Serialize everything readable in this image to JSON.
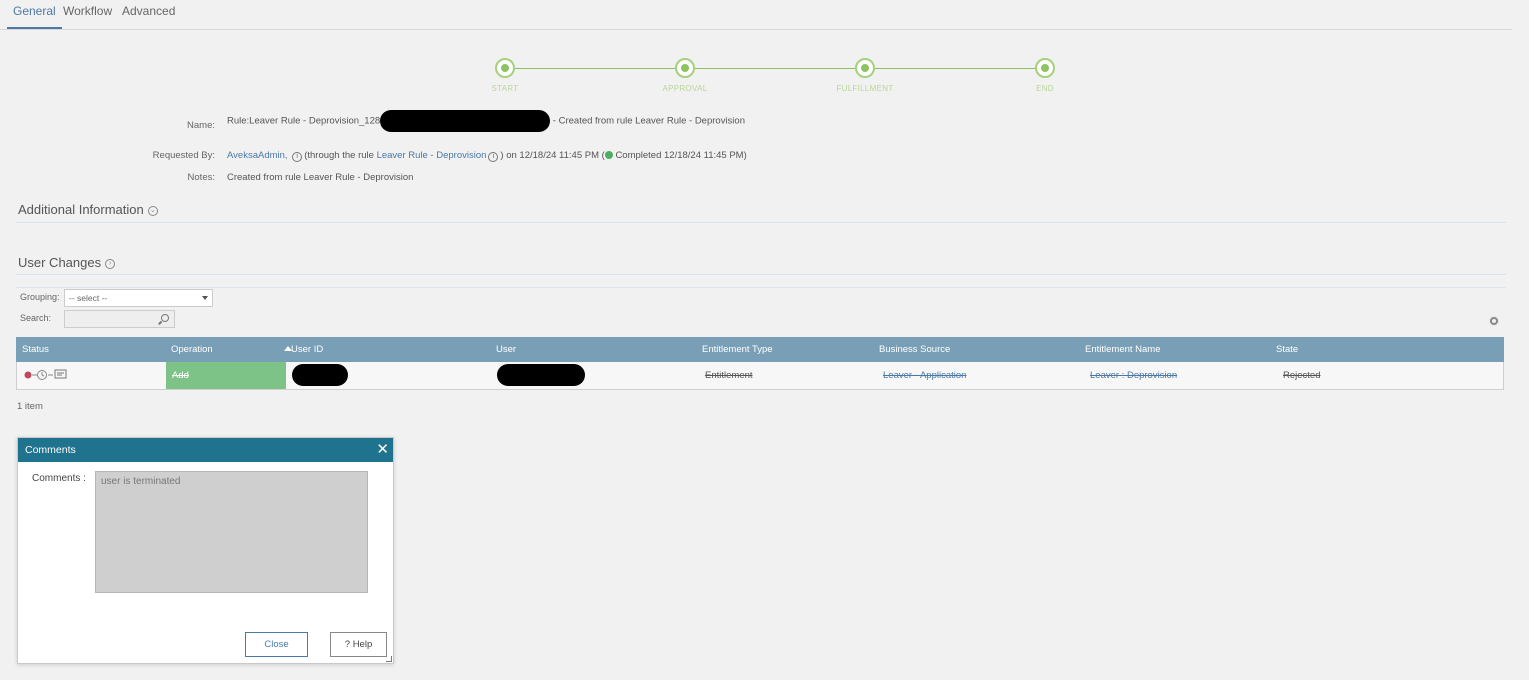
{
  "tabs": [
    {
      "label": "General",
      "active": true
    },
    {
      "label": "Workflow",
      "active": false
    },
    {
      "label": "Advanced",
      "active": false
    }
  ],
  "progress": {
    "steps": [
      "START",
      "APPROVAL",
      "FULFILLMENT",
      "END"
    ]
  },
  "details": {
    "name_label": "Name:",
    "name_prefix": "Rule:Leaver Rule - Deprovision_128",
    "name_suffix": "- Created from rule Leaver Rule - Deprovision",
    "requested_label": "Requested By:",
    "requester": "AveksaAdmin,",
    "through_text": "(through the rule",
    "rule_link": "Leaver Rule - Deprovision",
    "on_text": ") on 12/18/24 11:45 PM (",
    "completed_text": "Completed 12/18/24 11:45 PM)",
    "notes_label": "Notes:",
    "notes": "Created from rule Leaver Rule - Deprovision"
  },
  "sections": {
    "additional_info": "Additional Information",
    "user_changes": "User Changes"
  },
  "filters": {
    "grouping_label": "Grouping:",
    "grouping_value": "-- select --",
    "search_label": "Search:"
  },
  "table": {
    "columns": [
      "Status",
      "Operation",
      "User ID",
      "User",
      "Entitlement Type",
      "Business Source",
      "Entitlement Name",
      "State"
    ],
    "rows": [
      {
        "operation": "Add",
        "entitlement_type": "Entitlement",
        "business_source": "Leaver - Application",
        "entitlement_name": "Leaver : Deprovision",
        "state": "Rejected"
      }
    ],
    "count_text": "1 item"
  },
  "dialog": {
    "title": "Comments",
    "comments_label": "Comments :",
    "comments_value": "user is terminated",
    "close_label": "Close",
    "help_label": "? Help"
  },
  "colors": {
    "header_blue": "#799fb7",
    "dialog_header": "#20738f",
    "progress_green": "#8ec363",
    "operation_green": "#7dc287",
    "link_blue": "#4a79a8"
  }
}
